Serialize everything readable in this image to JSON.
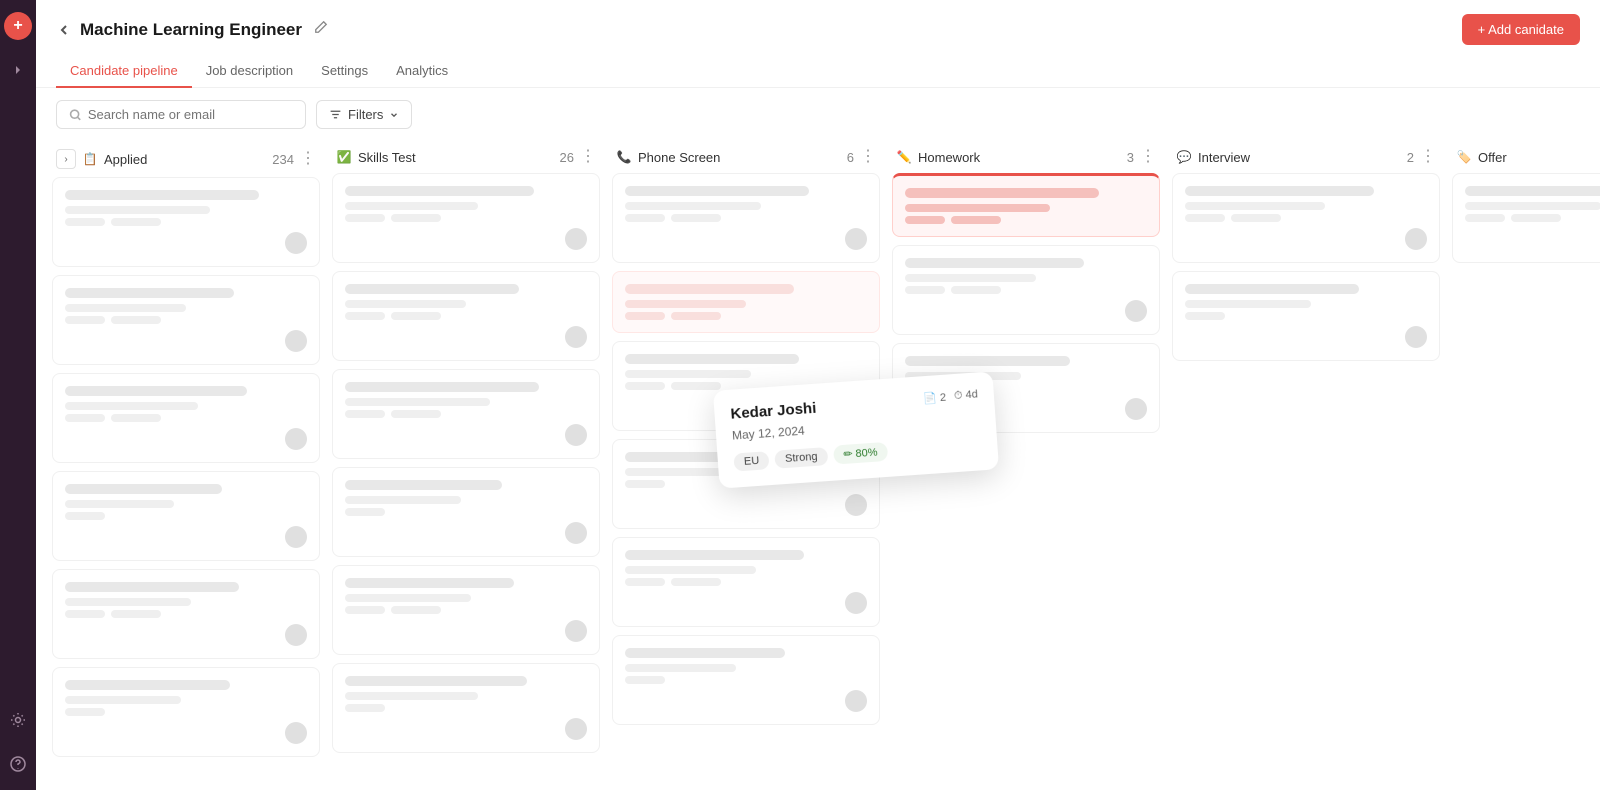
{
  "sidebar": {
    "logo": "+",
    "icons": [
      "»",
      "⚙",
      "?"
    ]
  },
  "header": {
    "title": "Machine Learning Engineer",
    "add_candidate_label": "+ Add canidate"
  },
  "tabs": [
    {
      "label": "Candidate pipeline",
      "active": true
    },
    {
      "label": "Job description",
      "active": false
    },
    {
      "label": "Settings",
      "active": false
    },
    {
      "label": "Analytics",
      "active": false
    }
  ],
  "toolbar": {
    "search_placeholder": "Search name or email",
    "filter_label": "Filters"
  },
  "columns": [
    {
      "id": "applied",
      "title": "Applied",
      "count": "234",
      "icon": "📋"
    },
    {
      "id": "skills",
      "title": "Skills Test",
      "count": "26",
      "icon": "✅"
    },
    {
      "id": "phone",
      "title": "Phone Screen",
      "count": "6",
      "icon": "📞"
    },
    {
      "id": "homework",
      "title": "Homework",
      "count": "3",
      "icon": "✏️"
    },
    {
      "id": "interview",
      "title": "Interview",
      "count": "2",
      "icon": "💬"
    },
    {
      "id": "offer",
      "title": "Offer",
      "count": "",
      "icon": "🏷️"
    }
  ],
  "tooltip": {
    "name": "Kedar Joshi",
    "date": "May 12, 2024",
    "score": "80%",
    "tag1": "EU",
    "tag2": "Strong",
    "files": "2",
    "days": "4d"
  }
}
